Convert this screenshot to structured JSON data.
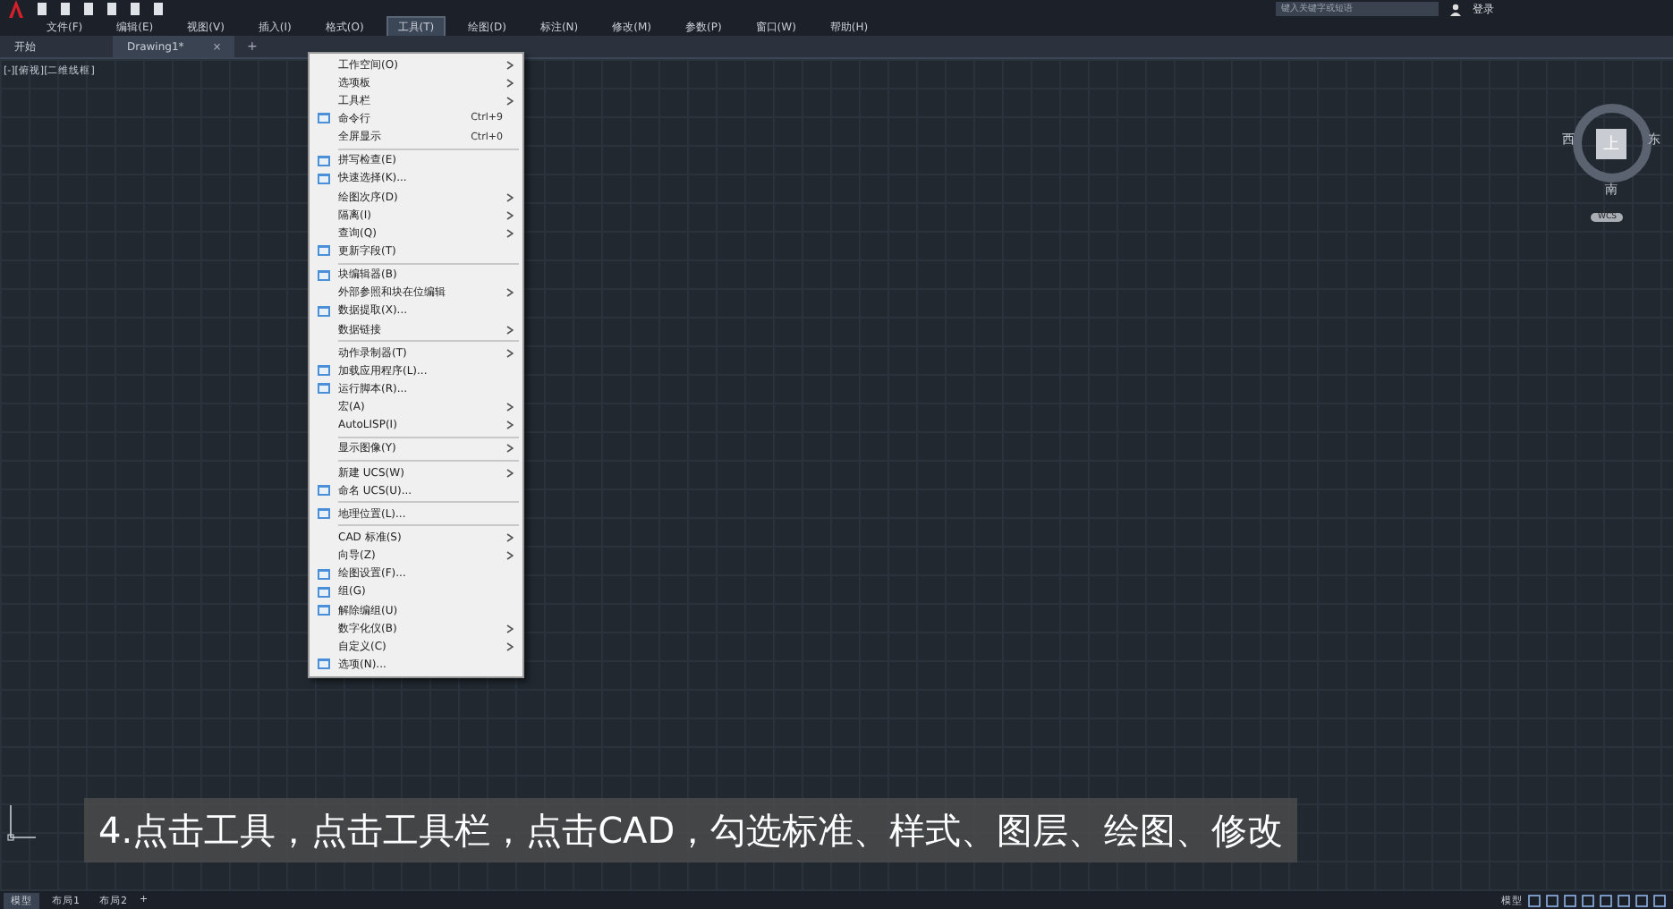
{
  "menubar": [
    {
      "label": "文件(F)",
      "selected": false
    },
    {
      "label": "编辑(E)",
      "selected": false
    },
    {
      "label": "视图(V)",
      "selected": false
    },
    {
      "label": "插入(I)",
      "selected": false
    },
    {
      "label": "格式(O)",
      "selected": false
    },
    {
      "label": "工具(T)",
      "selected": true
    },
    {
      "label": "绘图(D)",
      "selected": false
    },
    {
      "label": "标注(N)",
      "selected": false
    },
    {
      "label": "修改(M)",
      "selected": false
    },
    {
      "label": "参数(P)",
      "selected": false
    },
    {
      "label": "窗口(W)",
      "selected": false
    },
    {
      "label": "帮助(H)",
      "selected": false
    }
  ],
  "search": {
    "placeholder": "键入关键字或短语"
  },
  "login": "登录",
  "doc_tabs": [
    {
      "label": "开始",
      "selected": false
    },
    {
      "label": "Drawing1*",
      "selected": true,
      "close": "×"
    }
  ],
  "add_tab": "+",
  "viewport_label": "[-][俯视][二维线框]",
  "tools_menu": [
    [
      {
        "label": "工作空间(O)",
        "submenu": true,
        "icon": false
      },
      {
        "label": "选项板",
        "submenu": true,
        "icon": false
      },
      {
        "label": "工具栏",
        "submenu": true,
        "icon": false
      },
      {
        "label": "命令行",
        "shortcut": "Ctrl+9",
        "submenu": false,
        "icon": true
      },
      {
        "label": "全屏显示",
        "shortcut": "Ctrl+0",
        "submenu": false,
        "icon": false
      }
    ],
    [
      {
        "label": "拼写检查(E)",
        "submenu": false,
        "icon": true
      },
      {
        "label": "快速选择(K)...",
        "submenu": false,
        "icon": true
      },
      {
        "label": "绘图次序(D)",
        "submenu": true,
        "icon": false
      },
      {
        "label": "隔离(I)",
        "submenu": true,
        "icon": false
      },
      {
        "label": "查询(Q)",
        "submenu": true,
        "icon": false
      },
      {
        "label": "更新字段(T)",
        "submenu": false,
        "icon": true
      }
    ],
    [
      {
        "label": "块编辑器(B)",
        "submenu": false,
        "icon": true
      },
      {
        "label": "外部参照和块在位编辑",
        "submenu": true,
        "icon": false
      },
      {
        "label": "数据提取(X)...",
        "submenu": false,
        "icon": true
      },
      {
        "label": "数据链接",
        "submenu": true,
        "icon": false
      }
    ],
    [
      {
        "label": "动作录制器(T)",
        "submenu": true,
        "icon": false
      },
      {
        "label": "加载应用程序(L)...",
        "submenu": false,
        "icon": true
      },
      {
        "label": "运行脚本(R)...",
        "submenu": false,
        "icon": true
      },
      {
        "label": "宏(A)",
        "submenu": true,
        "icon": false
      },
      {
        "label": "AutoLISP(I)",
        "submenu": true,
        "icon": false
      }
    ],
    [
      {
        "label": "显示图像(Y)",
        "submenu": true,
        "icon": false
      }
    ],
    [
      {
        "label": "新建 UCS(W)",
        "submenu": true,
        "icon": false
      },
      {
        "label": "命名 UCS(U)...",
        "submenu": false,
        "icon": true
      }
    ],
    [
      {
        "label": "地理位置(L)...",
        "submenu": false,
        "icon": true
      }
    ],
    [
      {
        "label": "CAD 标准(S)",
        "submenu": true,
        "icon": false
      },
      {
        "label": "向导(Z)",
        "submenu": true,
        "icon": false
      },
      {
        "label": "绘图设置(F)...",
        "submenu": false,
        "icon": true
      },
      {
        "label": "组(G)",
        "submenu": false,
        "icon": true
      },
      {
        "label": "解除编组(U)",
        "submenu": false,
        "icon": true
      },
      {
        "label": "数字化仪(B)",
        "submenu": true,
        "icon": false
      },
      {
        "label": "自定义(C)",
        "submenu": true,
        "icon": false
      },
      {
        "label": "选项(N)...",
        "submenu": false,
        "icon": true
      }
    ]
  ],
  "viewcube": {
    "west": "西",
    "top": "上",
    "east": "东",
    "south": "南",
    "wcs": "WCS"
  },
  "subtitle": "4.点击工具，点击工具栏，点击CAD，勾选标准、样式、图层、绘图、修改",
  "layout_tabs": [
    {
      "label": "模型",
      "selected": true
    },
    {
      "label": "布局1",
      "selected": false
    },
    {
      "label": "布局2",
      "selected": false
    }
  ],
  "add_layout": "+",
  "status_mode": "模型"
}
